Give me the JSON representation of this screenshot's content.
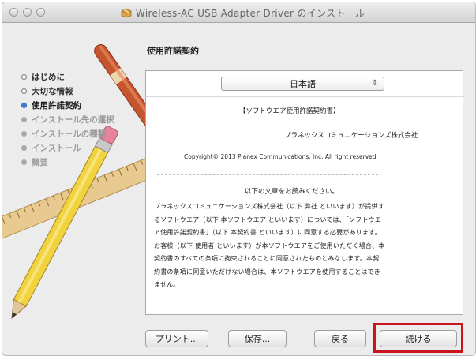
{
  "window": {
    "title": "Wireless-AC USB Adapter Driver のインストール"
  },
  "sidebar": {
    "steps": [
      {
        "label": "はじめに",
        "state": "done"
      },
      {
        "label": "大切な情報",
        "state": "done"
      },
      {
        "label": "使用許諾契約",
        "state": "current"
      },
      {
        "label": "インストール先の選択",
        "state": "todo"
      },
      {
        "label": "インストールの種類",
        "state": "todo"
      },
      {
        "label": "インストール",
        "state": "todo"
      },
      {
        "label": "概要",
        "state": "todo"
      }
    ]
  },
  "main": {
    "heading": "使用許諾契約",
    "language_select": {
      "value": "日本語",
      "arrow": "⇕"
    }
  },
  "license": {
    "title": "【ソフトウエア使用許諾契約書】",
    "company": "プラネックスコミュニケーションズ株式会社",
    "copyright": "Copyright© 2013 Planex Communications, Inc. All right reserved.",
    "notice": "以下の文章をお読みください。",
    "body_lines": [
      "プラネックスコミュニケーションズ株式会社（以下 弊社 といいます）が提供す",
      "るソフトウエア（以下 本ソフトウエア といいます）については、「ソフトウエ",
      "ア使用許諾契約書」（以下 本契約書 といいます）に同意する必要があります。",
      "お客様（以下 使用者 といいます）が本ソフトウエアをご使用いただく場合、本",
      "契約書のすべての条項に拘束されることに同意されたものとみなします。本契",
      "約書の条項に同意いただけない場合は、本ソフトウエアを使用することはでき",
      "ません。"
    ]
  },
  "buttons": {
    "print": "プリント...",
    "save": "保存...",
    "back": "戻る",
    "continue": "続ける"
  },
  "colors": {
    "highlight_frame": "#c8151e",
    "current_step_dot": "#3f7fdc",
    "window_bg": "#ececec"
  }
}
